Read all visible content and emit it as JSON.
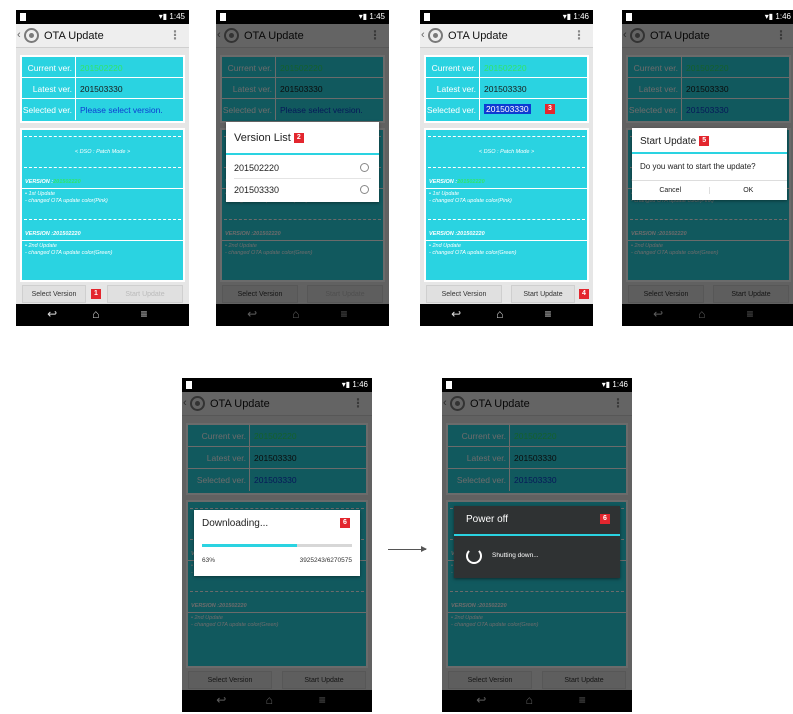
{
  "status_time_1": "1:45",
  "status_time_2": "1:46",
  "app_title": "OTA Update",
  "labels": {
    "current": "Current ver.",
    "latest": "Latest ver.",
    "selected": "Selected ver."
  },
  "values": {
    "current": "201502220",
    "latest": "201503330",
    "selected_placeholder": "Please select version.",
    "selected": "201503330"
  },
  "notes": {
    "mode": "< DSO : Patch Mode >",
    "version_prefix": "VERSION :",
    "version_1": "201502220",
    "item_1_line_1": "• 1st Update",
    "item_1_line_2": "- changed OTA update color(Pink)",
    "version_2_label": "VERSION :201502220",
    "item_2_line_1": "• 2nd Update",
    "item_2_line_2": "- changed OTA update color(Green)"
  },
  "buttons": {
    "select_version": "Select Version",
    "start_update": "Start Update"
  },
  "version_list": {
    "title": "Version List",
    "options": [
      "201502220",
      "201503330"
    ]
  },
  "start_dialog": {
    "title": "Start Update",
    "message": "Do you want to start the update?",
    "cancel": "Cancel",
    "ok": "OK"
  },
  "download_dialog": {
    "title": "Downloading...",
    "percent": "63%",
    "progress_fraction": 0.63,
    "bytes": "3925243/6270575"
  },
  "power_dialog": {
    "title": "Power off",
    "message": "Shutting down..."
  },
  "step_badges": [
    "1",
    "2",
    "3",
    "4",
    "5",
    "6"
  ],
  "nav_icons": [
    "back-icon",
    "home-icon",
    "recents-icon"
  ],
  "colors": {
    "cyan": "#2ad3e1",
    "badge_red": "#e3262e",
    "selected_blue": "#0d3bd2",
    "current_green": "#30e56a"
  }
}
